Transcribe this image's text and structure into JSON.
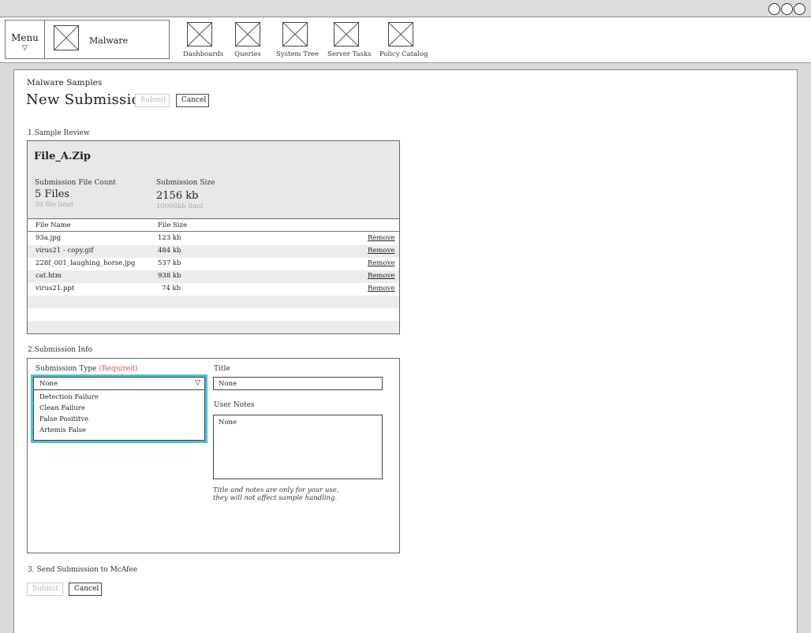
{
  "window": {
    "controls": [
      "circle",
      "circle",
      "circle"
    ]
  },
  "navbar": {
    "menu_label": "Menu",
    "menu_arrow": "▽",
    "app_logo_icon": "image-placeholder-icon",
    "app_name": "Malware",
    "items": [
      {
        "label": "Dashboards",
        "icon": "image-placeholder-icon"
      },
      {
        "label": "Queries",
        "icon": "image-placeholder-icon"
      },
      {
        "label": "System Tree",
        "icon": "image-placeholder-icon"
      },
      {
        "label": "Server Tasks",
        "icon": "image-placeholder-icon"
      },
      {
        "label": "Policy Catalog",
        "icon": "image-placeholder-icon"
      }
    ]
  },
  "page": {
    "breadcrumb": "Malware Samples",
    "title": "New Submission",
    "submit_label": "Submit",
    "cancel_label": "Cancel"
  },
  "review": {
    "section_label": "1.Sample Review",
    "file_name": "File_A.Zip",
    "count_label": "Submission File Count",
    "count_value": "5 Files",
    "count_limit": "30 file limit",
    "size_label": "Submission Size",
    "size_value": "2156 kb",
    "size_limit": "10000kb limit",
    "columns": [
      "File Name",
      "File Size"
    ],
    "remove_label": "Remove",
    "rows": [
      {
        "name": "93a.jpg",
        "size": "123 kb"
      },
      {
        "name": "virus21 - copy.gif",
        "size": "484 kb"
      },
      {
        "name": "228f_001_laughing_horse.jpg",
        "size": "537 kb"
      },
      {
        "name": "cat.htm",
        "size": "938 kb"
      },
      {
        "name": "virus21.ppt",
        "size": "74 kb"
      }
    ]
  },
  "info": {
    "section_label": "2.Submission Info",
    "type_label": "Submission Type",
    "type_required": "(Required)",
    "type_value": "None",
    "type_arrow": "▽",
    "type_options": [
      "Detection Failure",
      "Clean Failure",
      "False Posititve",
      "Artemis False"
    ],
    "title_label": "Title",
    "title_value": "None",
    "notes_label": "User Notes",
    "notes_value": "None",
    "note_line1": "Title and notes are only for your use,",
    "note_line2": "they will not affect sample handling."
  },
  "send": {
    "section_label": "3. Send Submission to McAfee",
    "submit_label": "Submit",
    "cancel_label": "Cancel"
  },
  "colors": {
    "highlight": "#4ec0e0",
    "required": "#d9534f",
    "panel_gray": "#e7e8e9"
  }
}
